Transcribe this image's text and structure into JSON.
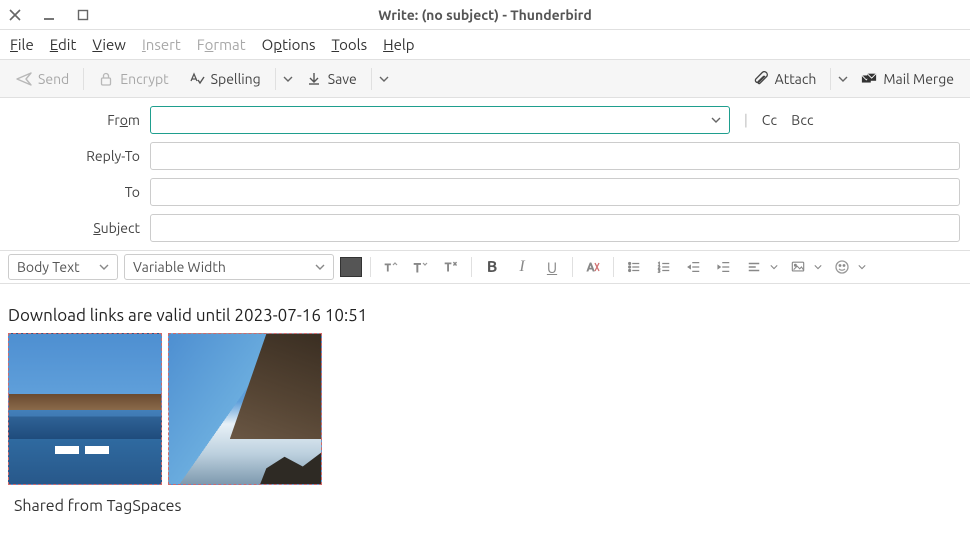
{
  "window": {
    "title": "Write: (no subject) - Thunderbird"
  },
  "menu": {
    "file": "File",
    "edit": "Edit",
    "view": "View",
    "insert": "Insert",
    "format": "Format",
    "options": "Options",
    "tools": "Tools",
    "help": "Help"
  },
  "toolbar": {
    "send": "Send",
    "encrypt": "Encrypt",
    "spelling": "Spelling",
    "save": "Save",
    "attach": "Attach",
    "mailmerge": "Mail Merge"
  },
  "headers": {
    "from_label": "From",
    "from_value": "",
    "cc": "Cc",
    "bcc": "Bcc",
    "replyto_label": "Reply-To",
    "replyto_value": "",
    "to_label": "To",
    "to_value": "",
    "subject_label": "Subject",
    "subject_value": ""
  },
  "format": {
    "paragraph_style": "Body Text",
    "font_face": "Variable Width"
  },
  "body": {
    "download_line": "Download links are valid until 2023-07-16 10:51",
    "shared_line": "Shared from TagSpaces"
  }
}
